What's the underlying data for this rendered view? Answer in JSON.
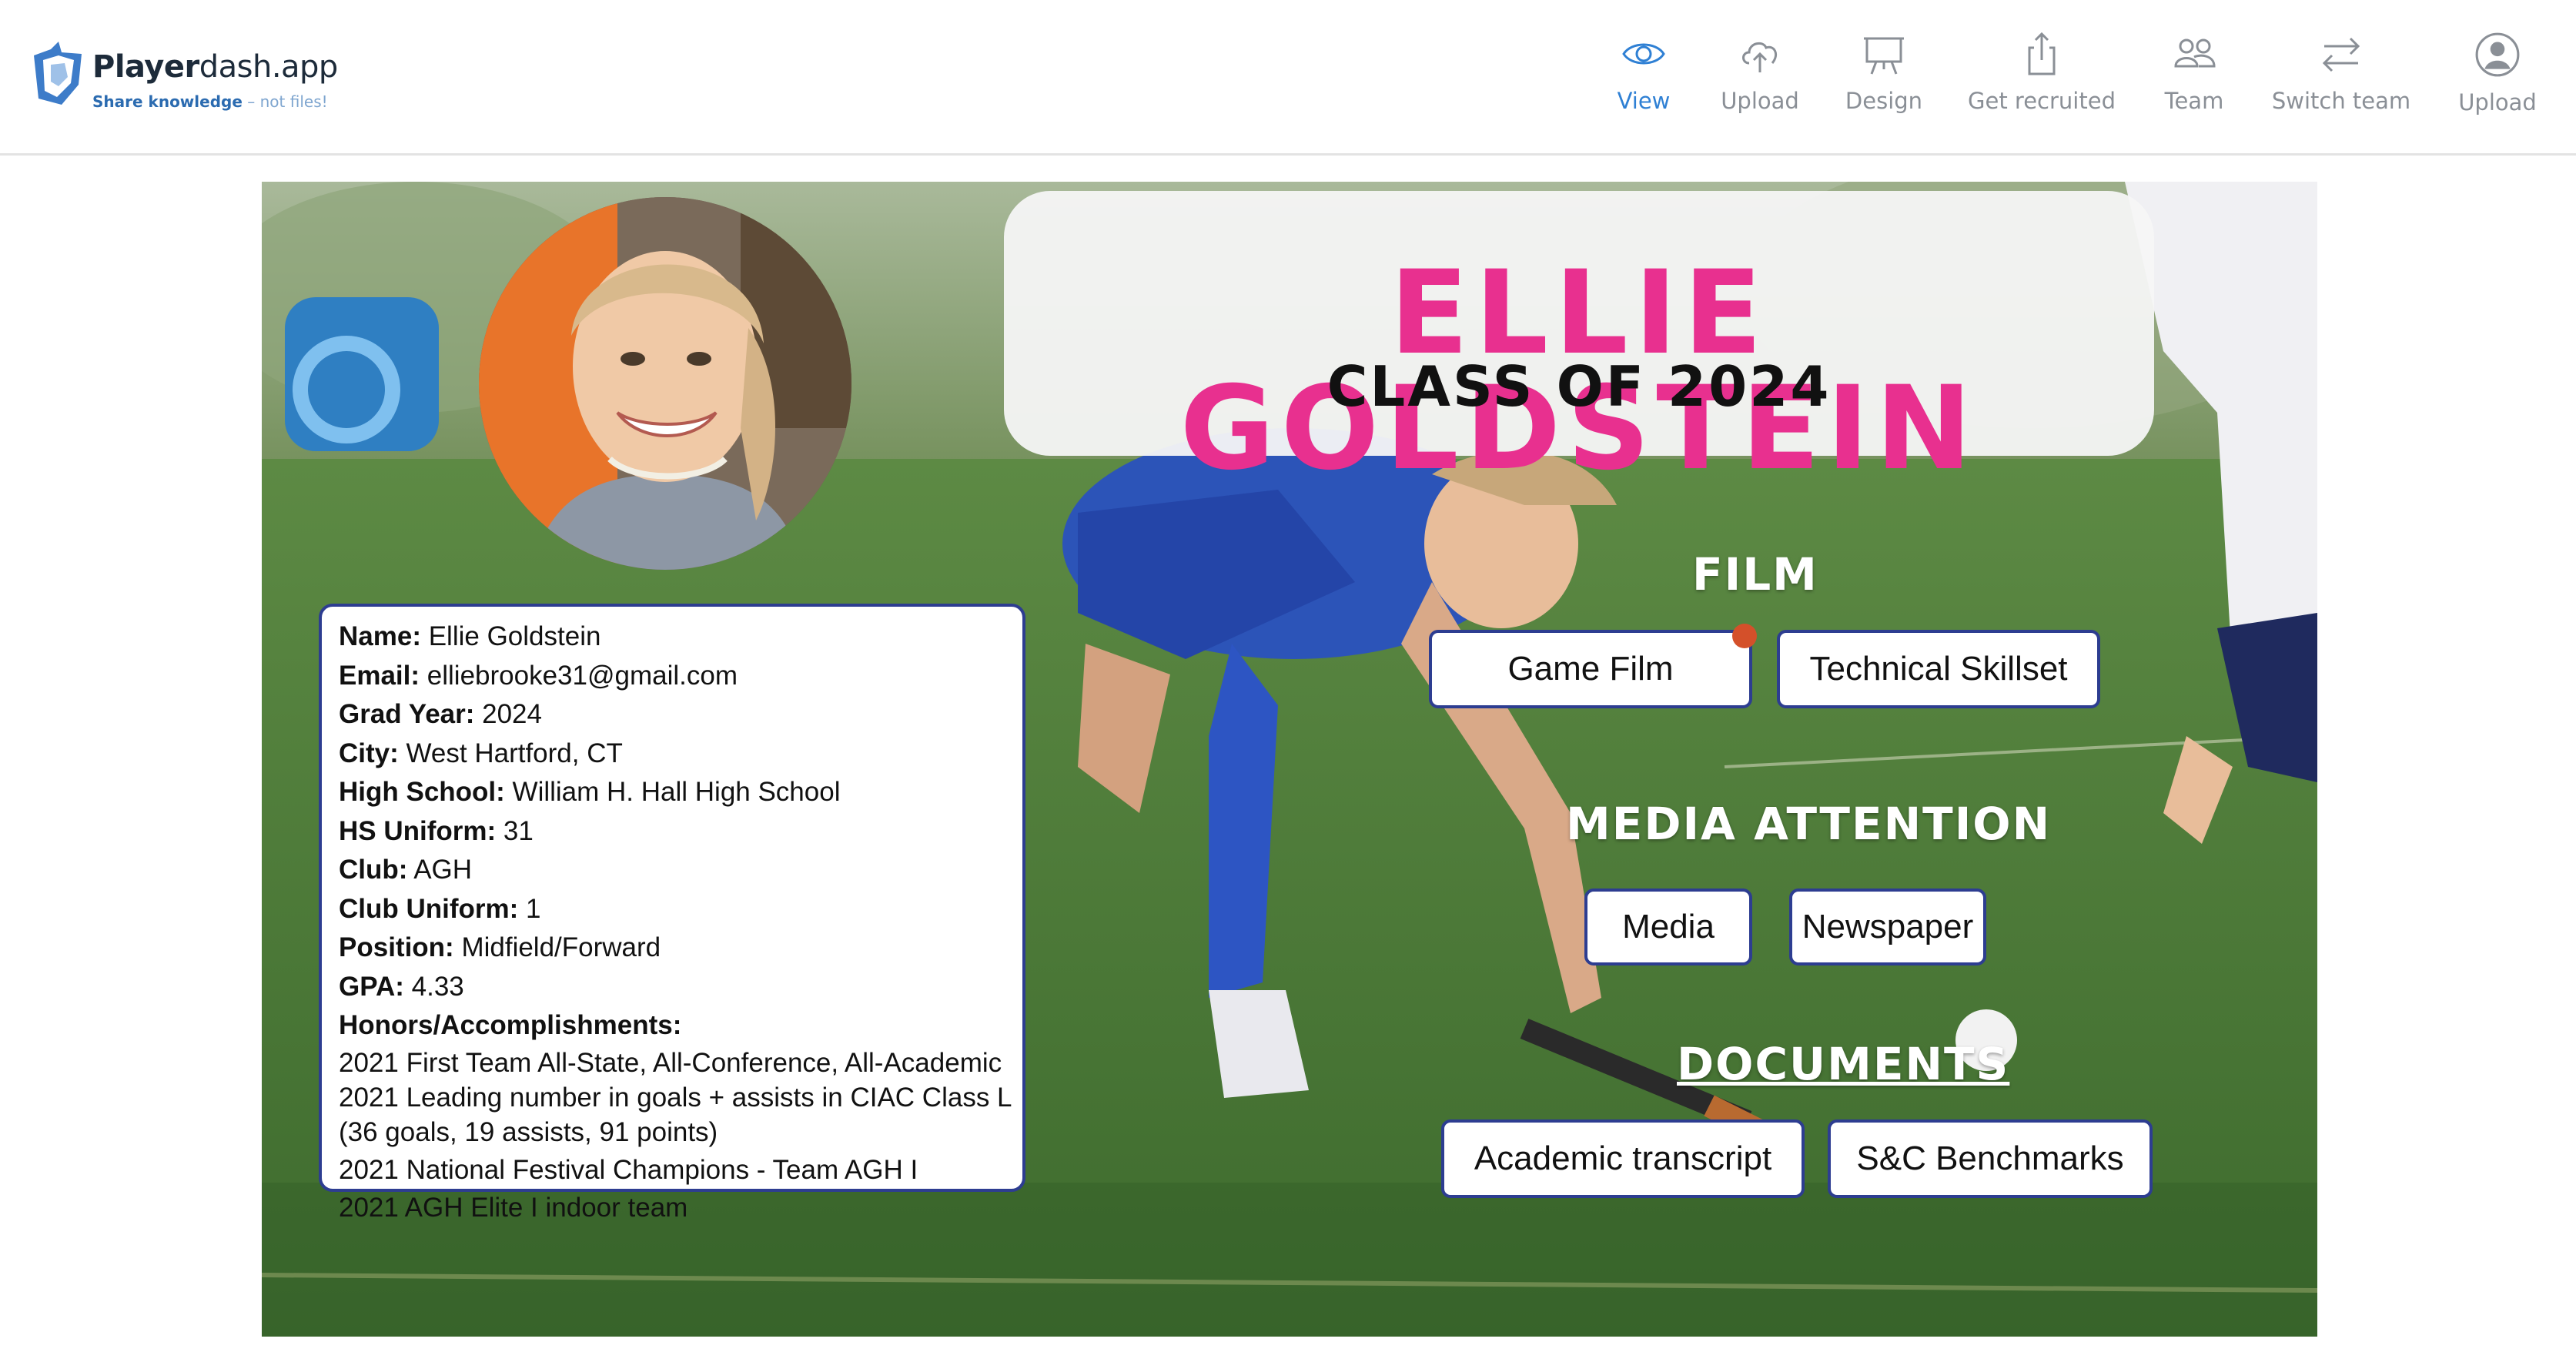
{
  "brand": {
    "name_bold": "Player",
    "name_rest": "dash.app",
    "tagline_bold": "Share knowledge",
    "tagline_light": " – not files!"
  },
  "nav": [
    {
      "label": "View",
      "icon": "eye-icon",
      "active": true
    },
    {
      "label": "Upload",
      "icon": "cloud-upload-icon",
      "active": false
    },
    {
      "label": "Design",
      "icon": "easel-icon",
      "active": false
    },
    {
      "label": "Get recruited",
      "icon": "share-icon",
      "active": false
    },
    {
      "label": "Team",
      "icon": "team-icon",
      "active": false
    },
    {
      "label": "Switch team",
      "icon": "swap-icon",
      "active": false
    },
    {
      "label": "Upload",
      "icon": "user-circle-icon",
      "active": false
    }
  ],
  "profile": {
    "name_title": "ELLIE GOLDSTEIN",
    "class_title": "CLASS OF 2024",
    "fields": [
      {
        "label": "Name:",
        "value": " Ellie Goldstein"
      },
      {
        "label": "Email:",
        "value": " elliebrooke31@gmail.com"
      },
      {
        "label": "Grad Year:",
        "value": " 2024"
      },
      {
        "label": "City:",
        "value": " West Hartford, CT"
      },
      {
        "label": "High School:",
        "value": " William H. Hall High School"
      },
      {
        "label": "HS Uniform:",
        "value": " 31"
      },
      {
        "label": "Club:",
        "value": " AGH"
      },
      {
        "label": "Club Uniform:",
        "value": " 1"
      },
      {
        "label": "Position:",
        "value": " Midfield/Forward"
      },
      {
        "label": "GPA:",
        "value": " 4.33"
      }
    ],
    "honors_label": "Honors/Accomplishments:",
    "honors": [
      "2021 First Team All-State, All-Conference, All-Academic",
      "2021 Leading number in goals + assists in CIAC Class L",
      "(36 goals, 19 assists, 91 points)",
      "2021 National Festival Champions - Team AGH I",
      "2021 AGH Elite I indoor team"
    ]
  },
  "sections": {
    "film": {
      "heading": "FILM",
      "buttons": [
        "Game Film",
        "Technical Skillset"
      ]
    },
    "media": {
      "heading": "MEDIA ATTENTION",
      "buttons": [
        "Media",
        "Newspaper"
      ]
    },
    "documents": {
      "heading": "DOCUMENTS",
      "buttons": [
        "Academic transcript",
        "S&C Benchmarks"
      ]
    }
  },
  "colors": {
    "accent_nav": "#2f80d4",
    "name_pink": "#e8308f",
    "button_border": "#2d3d91",
    "notification_dot": "#d4502a"
  }
}
